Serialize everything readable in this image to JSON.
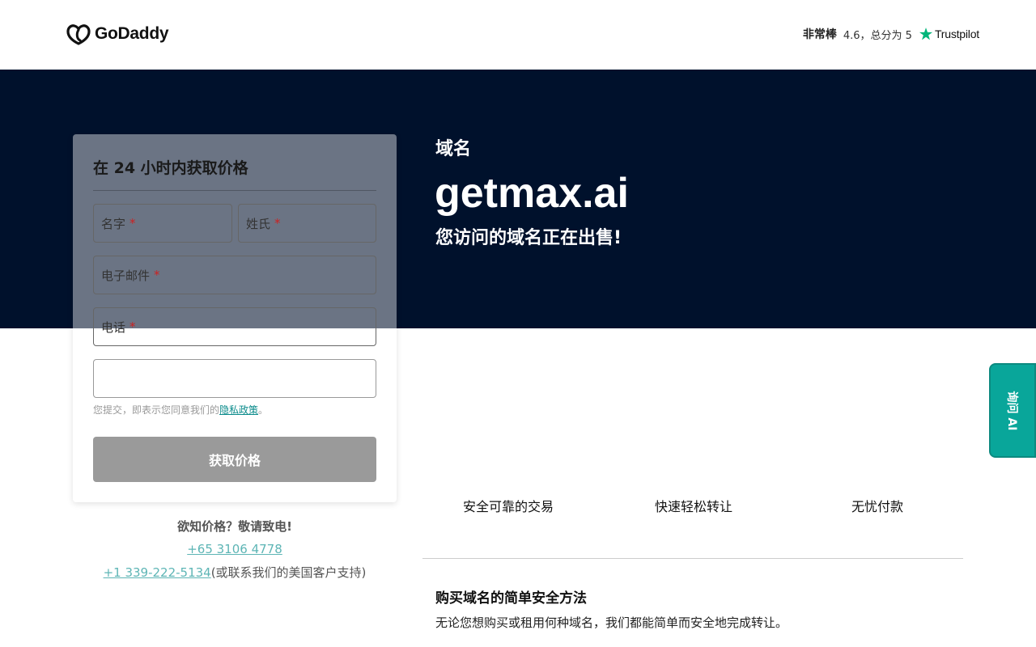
{
  "header": {
    "logo_text": "GoDaddy",
    "rating_word": "非常棒",
    "rating_detail": "4.6，总分为 5",
    "trustpilot": "Trustpilot"
  },
  "hero": {
    "label": "域名",
    "domain": "getmax.ai",
    "subtitle": "您访问的域名正在出售!"
  },
  "form": {
    "title": "在 24 小时内获取价格",
    "first_name": "名字",
    "last_name": "姓氏",
    "email": "电子邮件",
    "phone": "电话",
    "required_mark": "*",
    "consent_prefix": "您提交，即表示您同意我们的",
    "consent_link": "隐私政策",
    "consent_suffix": "。",
    "submit": "获取价格"
  },
  "call": {
    "title": "欲知价格？敬请致电!",
    "phone_sg": "+65 3106 4778",
    "phone_us": "+1 339-222-5134",
    "phone_us_note": "(或联系我们的美国客户支持)"
  },
  "features": [
    "安全可靠的交易",
    "快速轻松转让",
    "无忧付款"
  ],
  "section": {
    "title": "购买域名的简单安全方法",
    "text": "无论您想购买或租用何种域名，我们都能简单而安全地完成转让。"
  },
  "ai_tab": "询问 AI",
  "colors": {
    "hero_bg": "#00112c",
    "accent_teal": "#09a69a",
    "trustpilot_green": "#00b67a"
  }
}
